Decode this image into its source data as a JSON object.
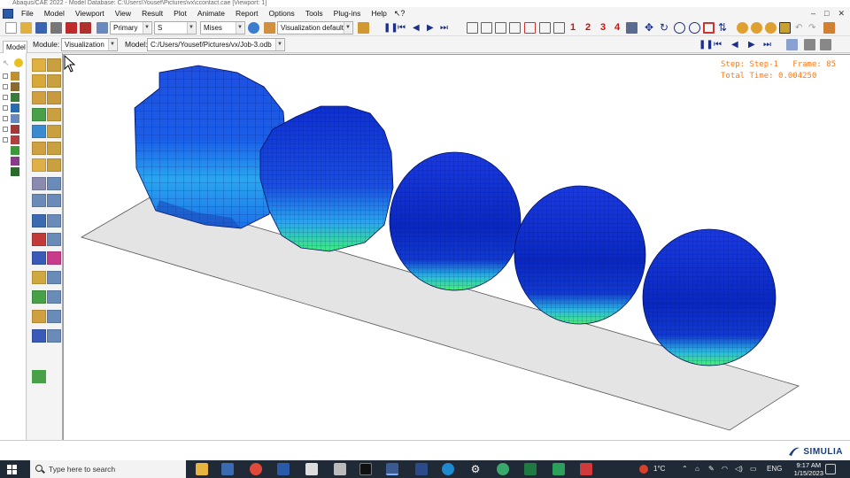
{
  "window": {
    "title": "Abaqus/CAE 2022 - Model Database: C:\\Users\\Yousef\\Pictures\\vx\\ccontact.cae [Viewport: 1]",
    "controls": [
      "–",
      "□",
      "✕"
    ]
  },
  "menu": [
    "File",
    "Model",
    "Viewport",
    "View",
    "Result",
    "Plot",
    "Animate",
    "Report",
    "Options",
    "Tools",
    "Plug-ins",
    "Help"
  ],
  "toolbar": {
    "primary_select": "Primary",
    "field_select": "S",
    "invariant_select": "Mises",
    "defaults_select": "Visualization defaults",
    "view_numbers": [
      "1",
      "2",
      "3",
      "4"
    ]
  },
  "context_bar": {
    "module_label": "Module:",
    "module_value": "Visualization",
    "model_label": "Model:",
    "model_value": "C:/Users/Yousef/Pictures/vx/Job-3.odb"
  },
  "model_tab": "Model",
  "viewport": {
    "step_label": "Step: Step-1",
    "frame_label": "Frame: 85",
    "total_time_label": "Total Time: 0.004250"
  },
  "brand": "SIMULIA",
  "taskbar": {
    "search_placeholder": "Type here to search",
    "temperature": "1°C",
    "language": "ENG",
    "time": "9:17 AM",
    "date": "1/15/2023"
  },
  "colors": {
    "contour_blue": "#0a2fc8",
    "contour_light": "#2aa6f0",
    "contour_green": "#3cf07a",
    "step_text": "#ff7a1a",
    "floor": "#e4e4e4"
  }
}
